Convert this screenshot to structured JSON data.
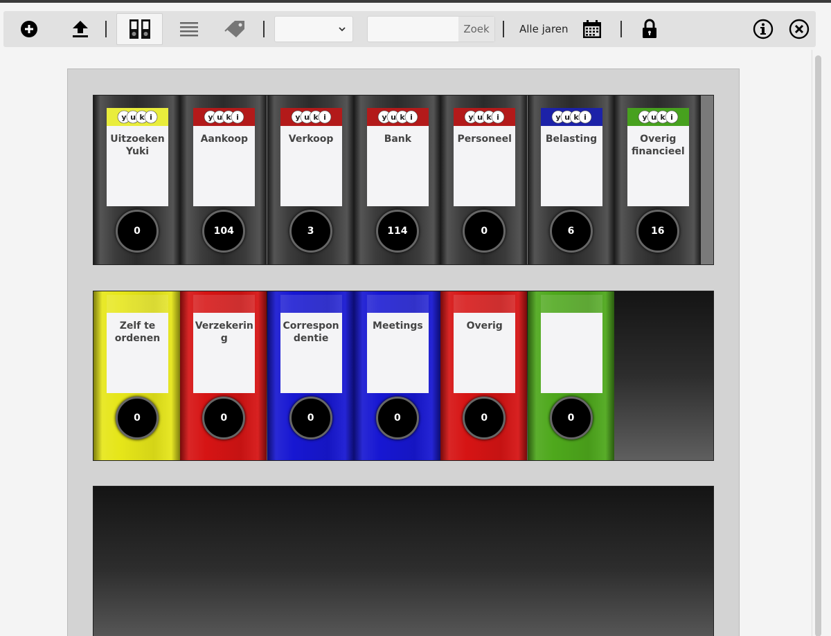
{
  "toolbar": {
    "add_icon": "plus-circle-icon",
    "upload_icon": "upload-icon",
    "grid_view_icon": "binder-view-icon",
    "list_view_icon": "list-icon",
    "tags_icon": "tag-icon",
    "select_value": "",
    "search_placeholder": "",
    "search_button": "Zoek",
    "years_label": "Alle jaren",
    "calendar_icon": "calendar-icon",
    "lock_icon": "lock-icon",
    "info_icon": "info-icon",
    "close_icon": "close-icon"
  },
  "brand_tag": "yuki",
  "shelves": [
    {
      "binders": [
        {
          "label": "Uitzoeken Yuki",
          "count": "0",
          "tag_color": "#e9ed3c"
        },
        {
          "label": "Aankoop",
          "count": "104",
          "tag_color": "#b31a1a"
        },
        {
          "label": "Verkoop",
          "count": "3",
          "tag_color": "#b31a1a"
        },
        {
          "label": "Bank",
          "count": "114",
          "tag_color": "#b31a1a"
        },
        {
          "label": "Personeel",
          "count": "0",
          "tag_color": "#b31a1a"
        },
        {
          "label": "Belasting",
          "count": "6",
          "tag_color": "#1c22a8"
        },
        {
          "label": "Overig financieel",
          "count": "16",
          "tag_color": "#47a11e"
        }
      ]
    },
    {
      "binders": [
        {
          "label": "Zelf te ordenen",
          "count": "0",
          "color": "#e6e619"
        },
        {
          "label": "Verzekering",
          "count": "0",
          "color": "#d61414"
        },
        {
          "label": "Correspondentie",
          "count": "0",
          "color": "#1717d2"
        },
        {
          "label": "Meetings",
          "count": "0",
          "color": "#1717d2"
        },
        {
          "label": "Overig",
          "count": "0",
          "color": "#d61414"
        },
        {
          "label": "",
          "count": "0",
          "color": "#4ea81c"
        }
      ]
    }
  ]
}
